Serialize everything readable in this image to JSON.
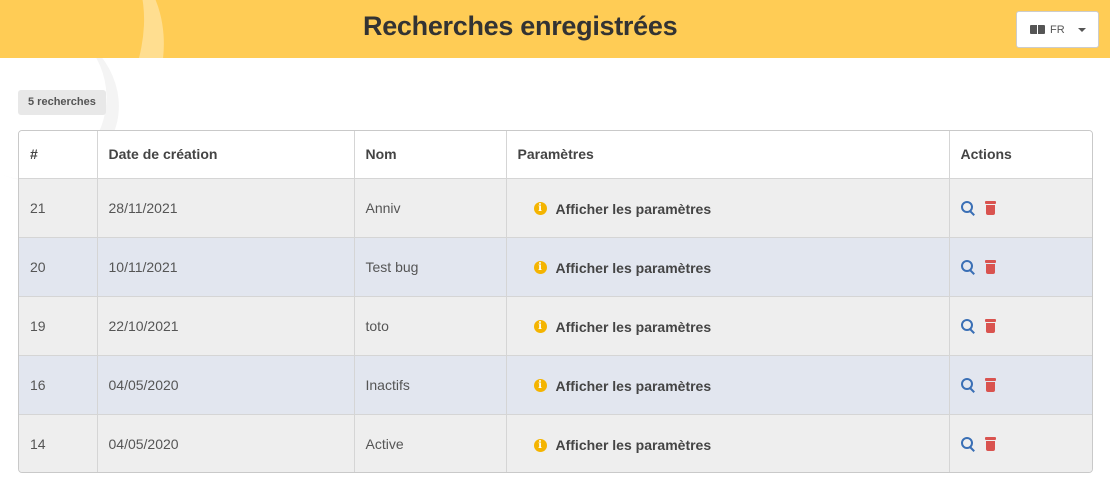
{
  "header": {
    "title": "Recherches enregistrées",
    "language": {
      "selected": "FR",
      "icon": "language-icon"
    },
    "background_color": "#ffcc55"
  },
  "summary": {
    "count_label": "5 recherches"
  },
  "table": {
    "columns": [
      "#",
      "Date de création",
      "Nom",
      "Paramètres",
      "Actions"
    ],
    "rows": [
      {
        "id": "21",
        "date": "28/11/2021",
        "name": "Anniv",
        "params_label": "Afficher les paramètres"
      },
      {
        "id": "20",
        "date": "10/11/2021",
        "name": "Test bug",
        "params_label": "Afficher les paramètres"
      },
      {
        "id": "19",
        "date": "22/10/2021",
        "name": "toto",
        "params_label": "Afficher les paramètres"
      },
      {
        "id": "16",
        "date": "04/05/2020",
        "name": "Inactifs",
        "params_label": "Afficher les paramètres"
      },
      {
        "id": "14",
        "date": "04/05/2020",
        "name": "Active",
        "params_label": "Afficher les paramètres"
      }
    ],
    "row_actions": [
      {
        "icon": "search-icon",
        "color": "#3a6fb5"
      },
      {
        "icon": "trash-icon",
        "color": "#d9534f"
      }
    ]
  },
  "colors": {
    "info": "#f4b400",
    "row_odd": "#eeeeee",
    "row_even": "#e2e6ef"
  }
}
